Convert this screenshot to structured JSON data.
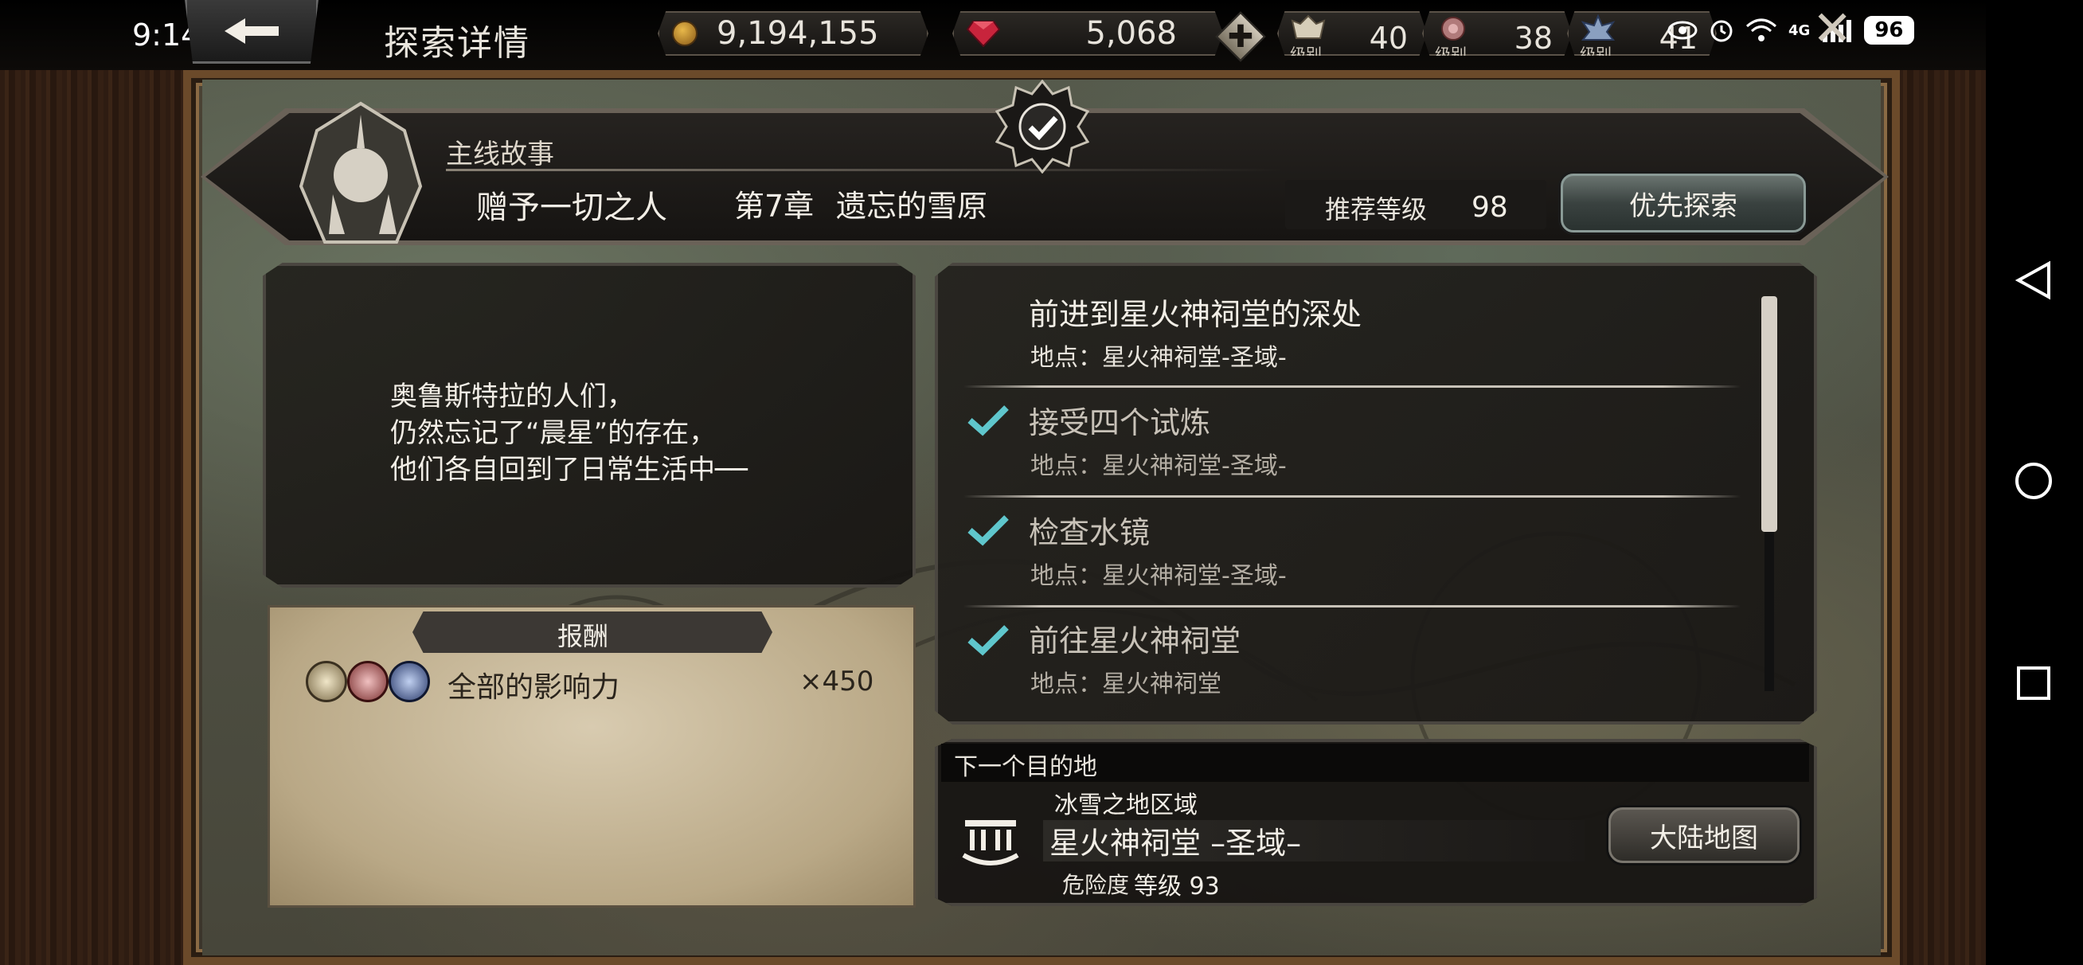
{
  "status_bar": {
    "time": "9:14",
    "battery": "96",
    "network": "4G"
  },
  "header": {
    "title": "探索详情",
    "gold": "9,194,155",
    "gems": "5,068",
    "add_symbol": "✚",
    "close_symbol": "✕",
    "levels": [
      {
        "icon": "noble-crest-icon",
        "caption": "级别",
        "value": "40"
      },
      {
        "icon": "rose-crest-icon",
        "caption": "级别",
        "value": "38"
      },
      {
        "icon": "sword-crest-icon",
        "caption": "级别",
        "value": "41"
      }
    ]
  },
  "banner": {
    "category": "主线故事",
    "story": "赠予一切之人",
    "chapter": "第7章",
    "chapter_name": "遗忘的雪原",
    "recommended_label": "推荐等级",
    "recommended_level": "98",
    "priority_button": "优先探索"
  },
  "story": {
    "lines": [
      "奥鲁斯特拉的人们，",
      "仍然忘记了“晨星”的存在，",
      "他们各自回到了日常生活中──"
    ]
  },
  "rewards": {
    "title": "报酬",
    "items": [
      {
        "name": "全部的影响力",
        "quantity": "×450"
      }
    ]
  },
  "objectives": [
    {
      "title": "前进到星火神祠堂的深处",
      "location": "地点：星火神祠堂-圣域-",
      "done": false
    },
    {
      "title": "接受四个试炼",
      "location": "地点：星火神祠堂-圣域-",
      "done": true
    },
    {
      "title": "检查水镜",
      "location": "地点：星火神祠堂-圣域-",
      "done": true
    },
    {
      "title": "前往星火神祠堂",
      "location": "地点：星火神祠堂",
      "done": true
    }
  ],
  "next_destination": {
    "label": "下一个目的地",
    "region": "冰雪之地区域",
    "name": "星火神祠堂 –圣域–",
    "danger_label": "危险度",
    "danger_value": "等级 93",
    "map_button": "大陆地图"
  },
  "colors": {
    "accent_check": "#5fc6cc",
    "parchment": "#c8b894",
    "gold": "#e8b84a",
    "gem": "#c8243c"
  }
}
